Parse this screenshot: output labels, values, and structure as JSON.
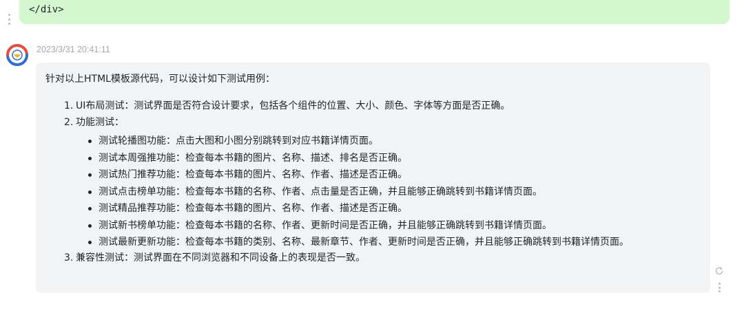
{
  "user_message": {
    "code_text": "</div>"
  },
  "bot_message": {
    "timestamp": "2023/3/31 20:41:11",
    "intro": "针对以上HTML模板源代码，可以设计如下测试用例：",
    "steps": [
      {
        "num": "1.",
        "text": "UI布局测试：测试界面是否符合设计要求，包括各个组件的位置、大小、颜色、字体等方面是否正确。"
      },
      {
        "num": "2.",
        "text": "功能测试：",
        "subs": [
          "测试轮播图功能：点击大图和小图分别跳转到对应书籍详情页面。",
          "测试本周强推功能：检查每本书籍的图片、名称、描述、排名是否正确。",
          "测试热门推荐功能：检查每本书籍的图片、名称、作者、描述是否正确。",
          "测试点击榜单功能：检查每本书籍的名称、作者、点击量是否正确，并且能够正确跳转到书籍详情页面。",
          "测试精品推荐功能：检查每本书籍的图片、名称、作者、描述是否正确。",
          "测试新书榜单功能：检查每本书籍的名称、作者、更新时间是否正确，并且能够正确跳转到书籍详情页面。",
          "测试最新更新功能：检查每本书籍的类别、名称、最新章节、作者、更新时间是否正确，并且能够正确跳转到书籍详情页面。"
        ]
      },
      {
        "num": "3.",
        "text": "兼容性测试：测试界面在不同浏览器和不同设备上的表现是否一致。"
      }
    ]
  },
  "icons": {
    "avatar": "bot-avatar-icon",
    "regenerate": "refresh-icon",
    "more": "more-vertical-icon",
    "drag": "drag-handle-icon"
  },
  "colors": {
    "user_bubble": "#d4f7cf",
    "bot_bubble": "#f2f3f5",
    "timestamp": "#a3a8b0",
    "avatar_red": "#e84b3c",
    "avatar_blue": "#2b6fd6",
    "avatar_yellow": "#f5b623"
  }
}
